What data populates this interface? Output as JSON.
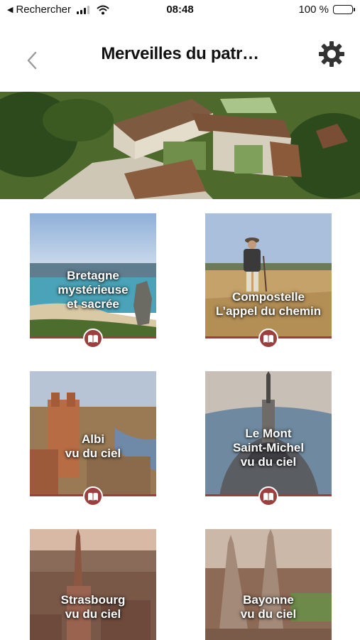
{
  "status_bar": {
    "back_app": "Rechercher",
    "time": "08:48",
    "battery": "100 %"
  },
  "nav": {
    "title": "Merveilles du patr…",
    "back_icon": "chevron-left-icon",
    "settings_icon": "gear-icon"
  },
  "hero": {
    "description_icon": "abbey-aerial-photo"
  },
  "cards": [
    {
      "lines": [
        "Bretagne",
        "mystérieuse",
        "et sacrée"
      ],
      "icon": "book-icon"
    },
    {
      "lines": [
        "Compostelle",
        "L’appel du chemin"
      ],
      "icon": "book-icon"
    },
    {
      "lines": [
        "Albi",
        "vu du ciel"
      ],
      "icon": "book-icon"
    },
    {
      "lines": [
        "Le Mont",
        "Saint-Michel",
        "vu du ciel"
      ],
      "icon": "book-icon"
    },
    {
      "lines": [
        "Strasbourg",
        "vu du ciel"
      ]
    },
    {
      "lines": [
        "Bayonne",
        "vu du ciel"
      ]
    }
  ],
  "colors": {
    "accent": "#9b3f3f",
    "background": "#ffffff"
  }
}
